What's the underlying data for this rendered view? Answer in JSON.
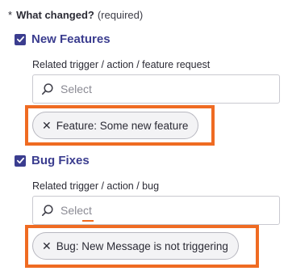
{
  "question": {
    "asterisk": "*",
    "label": "What changed?",
    "required_text": "(required)"
  },
  "sections": [
    {
      "checkbox_label": "New Features",
      "checked": true,
      "field_label": "Related trigger / action / feature request",
      "select_placeholder": "Select",
      "chip_close": "✕",
      "chip_text": "Feature: Some new feature"
    },
    {
      "checkbox_label": "Bug Fixes",
      "checked": true,
      "field_label": "Related trigger / action / bug",
      "select_placeholder": "Select",
      "chip_close": "✕",
      "chip_text": "Bug: New Message is not triggering"
    }
  ],
  "colors": {
    "accent": "#3b3d8f",
    "highlight": "#ef6b22",
    "chip_bg": "#f3f3f5"
  },
  "icons": {
    "checkbox": "checkmark-icon",
    "search": "search-icon",
    "remove": "close-icon"
  }
}
